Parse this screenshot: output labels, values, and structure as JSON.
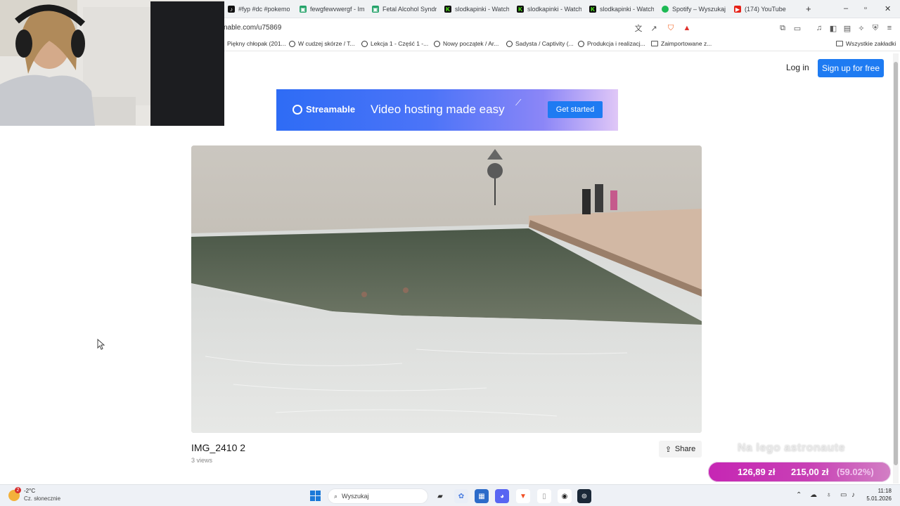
{
  "browser": {
    "tabs": [
      {
        "label": "#fyp #dc #pokemo",
        "icon": "tiktok-icon",
        "color": "#111111"
      },
      {
        "label": "fewgfewvwergf - Im",
        "icon": "image-icon",
        "color": "#25a36a"
      },
      {
        "label": "Fetal Alcohol Syndr",
        "icon": "image-icon",
        "color": "#25a36a"
      },
      {
        "label": "slodkapinki - Watch",
        "icon": "kick-icon",
        "color": "#111111"
      },
      {
        "label": "slodkapinki - Watch",
        "icon": "kick-icon",
        "color": "#111111"
      },
      {
        "label": "slodkapinki - Watch",
        "icon": "kick-icon",
        "color": "#111111"
      },
      {
        "label": "Spotify – Wyszukaj",
        "icon": "spotify-icon",
        "color": "#1db954"
      },
      {
        "label": "(174) YouTube",
        "icon": "youtube-icon",
        "color": "#e62117"
      }
    ],
    "new_tab": "+",
    "url": "nable.com/u75869",
    "bookmarks": [
      {
        "label": "Piękny chłopak (201...",
        "icon": "none"
      },
      {
        "label": "W cudzej skórze / T...",
        "icon": "globe-icon"
      },
      {
        "label": "Lekcja 1 - Część 1 -...",
        "icon": "globe-icon"
      },
      {
        "label": "Nowy początek / Ar...",
        "icon": "globe-icon"
      },
      {
        "label": "Sadysta / Captivity (...",
        "icon": "globe-icon"
      },
      {
        "label": "Produkcja i realizacj...",
        "icon": "globe-icon"
      },
      {
        "label": "Zaimportowane z...",
        "icon": "folder-icon"
      }
    ],
    "all_bookmarks": "Wszystkie zakładki"
  },
  "page": {
    "login": "Log in",
    "signup": "Sign up for free",
    "banner": {
      "brand": "Streamable",
      "tagline": "Video hosting made easy",
      "cta": "Get started"
    },
    "video": {
      "title": "IMG_2410 2",
      "views": "3 views",
      "share": "Share"
    }
  },
  "overlay": {
    "text": "Na lego astronaute",
    "donation": {
      "current": "126,89 zł",
      "goal": "215,00 zł",
      "percent": "(59.02%)"
    }
  },
  "taskbar": {
    "weather": {
      "temp": "-2°C",
      "condition": "Cz. słonecznie",
      "badge": "2"
    },
    "search_placeholder": "Wyszukaj",
    "time": "11:18",
    "date": "5.01.2026"
  },
  "colors": {
    "accent": "#1e7bf2",
    "donation": "#c626b4"
  }
}
